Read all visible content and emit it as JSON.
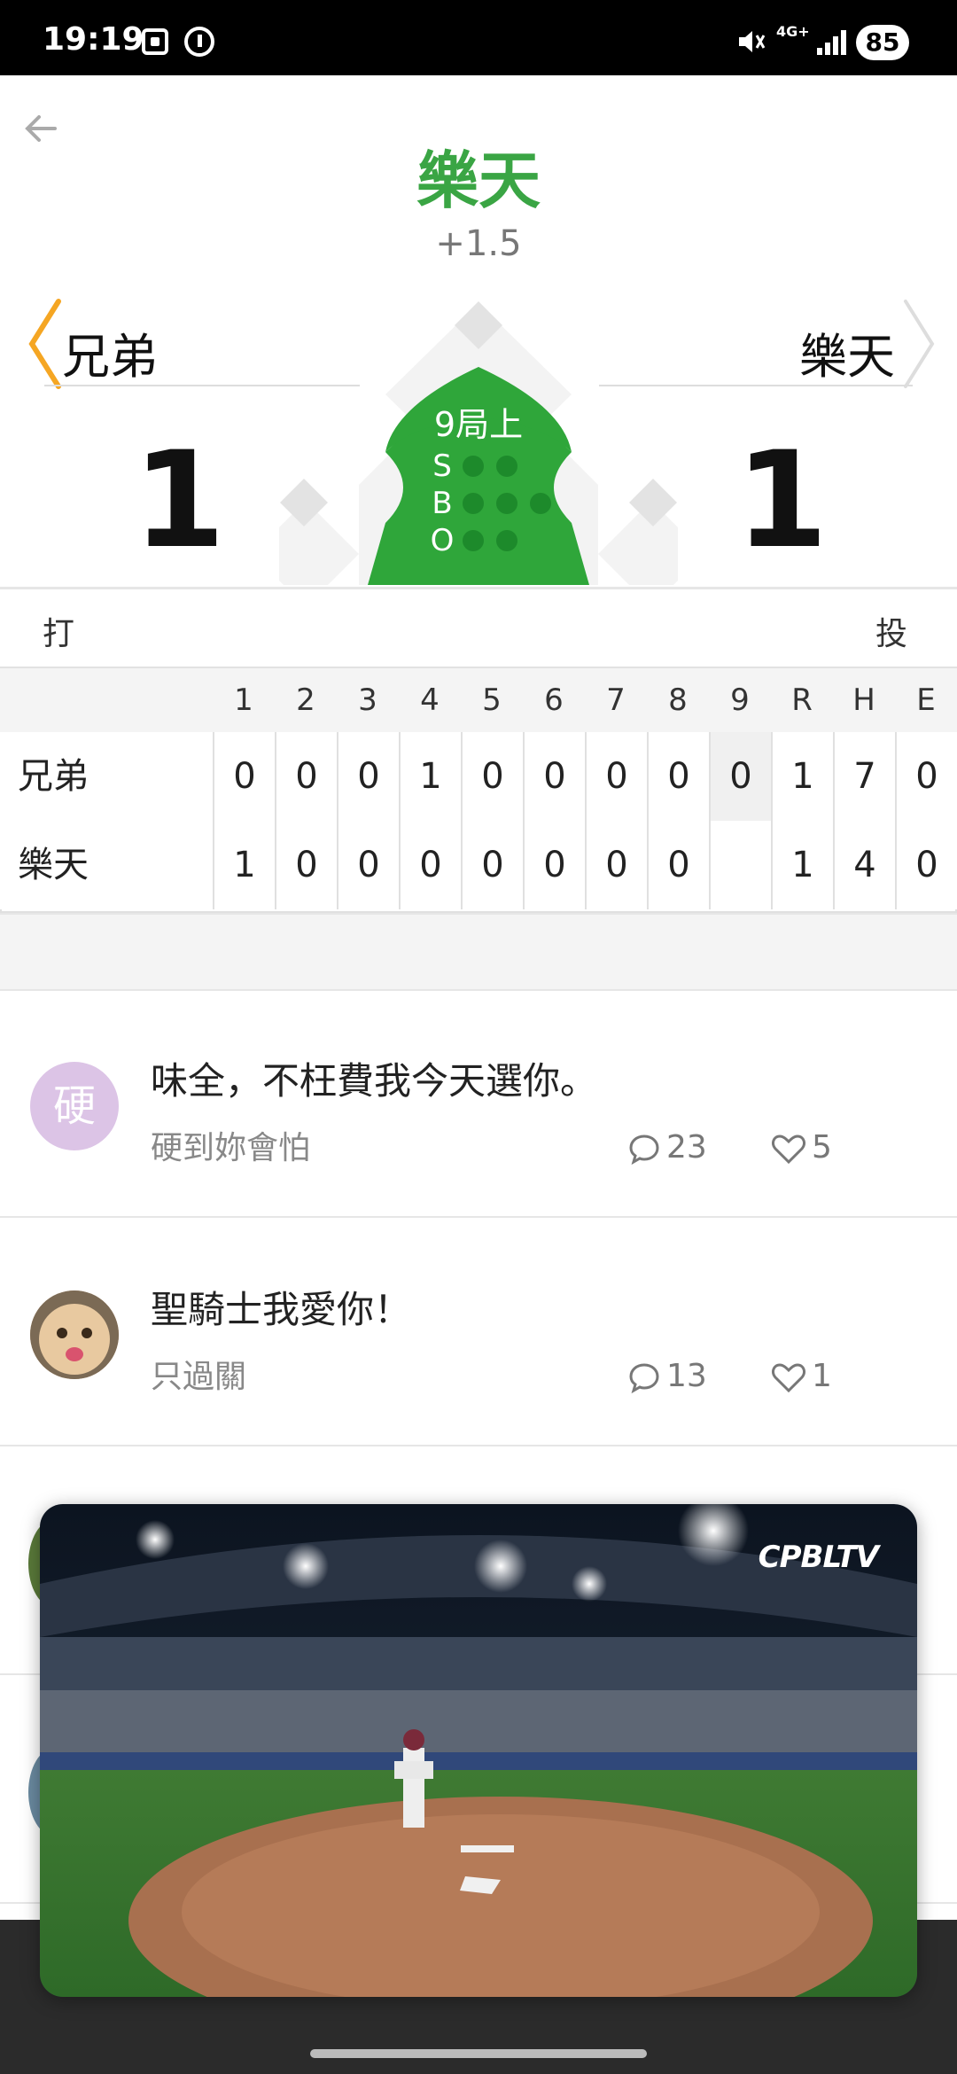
{
  "status_bar": {
    "time": "19:19",
    "network": "4G+",
    "battery": "85"
  },
  "header": {
    "title": "樂天",
    "odds": "+1.5"
  },
  "teams": {
    "away": "兄弟",
    "home": "樂天",
    "away_score": "1",
    "home_score": "1"
  },
  "count": {
    "inning": "9局上",
    "s_label": "S",
    "b_label": "B",
    "o_label": "O",
    "strikes": 2,
    "balls": 3,
    "outs": 2
  },
  "labels": {
    "batting": "打",
    "pitching": "投"
  },
  "linescore": {
    "headers": [
      "1",
      "2",
      "3",
      "4",
      "5",
      "6",
      "7",
      "8",
      "9",
      "R",
      "H",
      "E"
    ],
    "rows": [
      {
        "team": "兄弟",
        "cells": [
          "0",
          "0",
          "0",
          "1",
          "0",
          "0",
          "0",
          "0",
          "0",
          "1",
          "7",
          "0"
        ]
      },
      {
        "team": "樂天",
        "cells": [
          "1",
          "0",
          "0",
          "0",
          "0",
          "0",
          "0",
          "0",
          "",
          "1",
          "4",
          "0"
        ]
      }
    ]
  },
  "posts": [
    {
      "avatar_text": "硬",
      "title": "味全，不枉費我今天選你。",
      "author": "硬到妳會怕",
      "comments": "23",
      "likes": "5"
    },
    {
      "avatar_text": "",
      "title": "聖騎士我愛你！",
      "author": "只過關",
      "comments": "13",
      "likes": "1"
    }
  ],
  "video": {
    "logo": "CPBLTV"
  },
  "colors": {
    "accent_green": "#3aa544",
    "field_green": "#2fa63a",
    "arrow_orange": "#f5a623"
  }
}
